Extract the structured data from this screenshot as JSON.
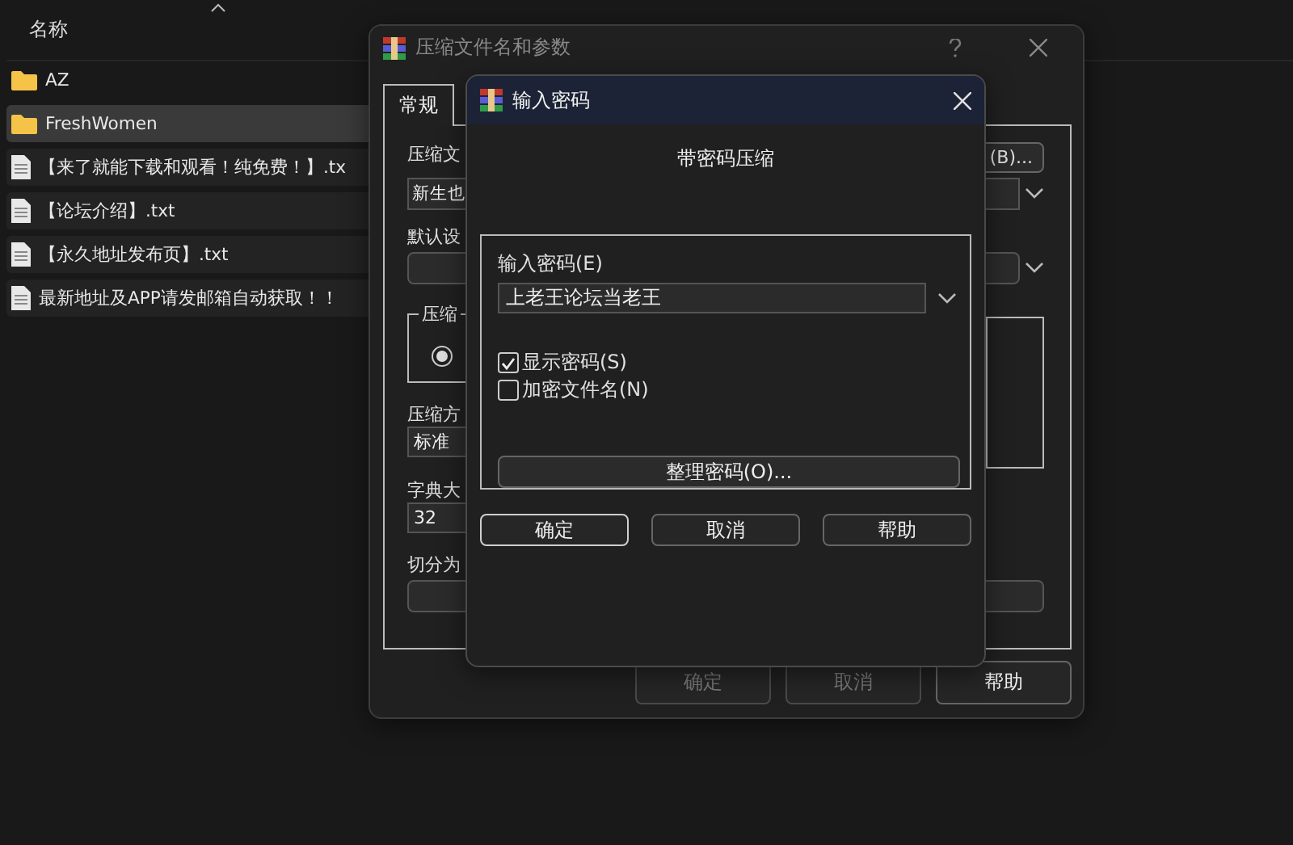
{
  "explorer": {
    "column_header": "名称",
    "items": [
      {
        "name": "AZ",
        "kind": "folder",
        "selected": false
      },
      {
        "name": "FreshWomen",
        "kind": "folder",
        "selected": true
      },
      {
        "name": "【来了就能下载和观看！纯免费！】.tx",
        "kind": "file",
        "selected": false
      },
      {
        "name": "【论坛介绍】.txt",
        "kind": "file",
        "selected": false
      },
      {
        "name": "【永久地址发布页】.txt",
        "kind": "file",
        "selected": false
      },
      {
        "name": "最新地址及APP请发邮箱自动获取！！",
        "kind": "file",
        "selected": false
      }
    ]
  },
  "archive_dialog": {
    "title": "压缩文件名和参数",
    "tabs": [
      {
        "label": "常规",
        "selected": true
      }
    ],
    "archive_name_label": "压缩文",
    "archive_name_value": "新生也",
    "browse_button": "(B)...",
    "default_profile_label": "默认设",
    "format_group_label": "压缩",
    "format_radio_selected": true,
    "method_label": "压缩方",
    "method_value": "标准",
    "dictionary_label": "字典大",
    "dictionary_value": "32",
    "split_label": "切分为",
    "buttons": [
      {
        "label": "确定",
        "disabled": true
      },
      {
        "label": "取消",
        "disabled": true
      },
      {
        "label": "帮助",
        "disabled": false
      }
    ]
  },
  "password_dialog": {
    "title": "输入密码",
    "heading": "带密码压缩",
    "password_label": "输入密码(E)",
    "password_value": "上老王论坛当老王",
    "options": [
      {
        "label": "显示密码(S)",
        "checked": true
      },
      {
        "label": "加密文件名(N)",
        "checked": false
      }
    ],
    "organize_button": "整理密码(O)...",
    "buttons": [
      "确定",
      "取消",
      "帮助"
    ]
  }
}
